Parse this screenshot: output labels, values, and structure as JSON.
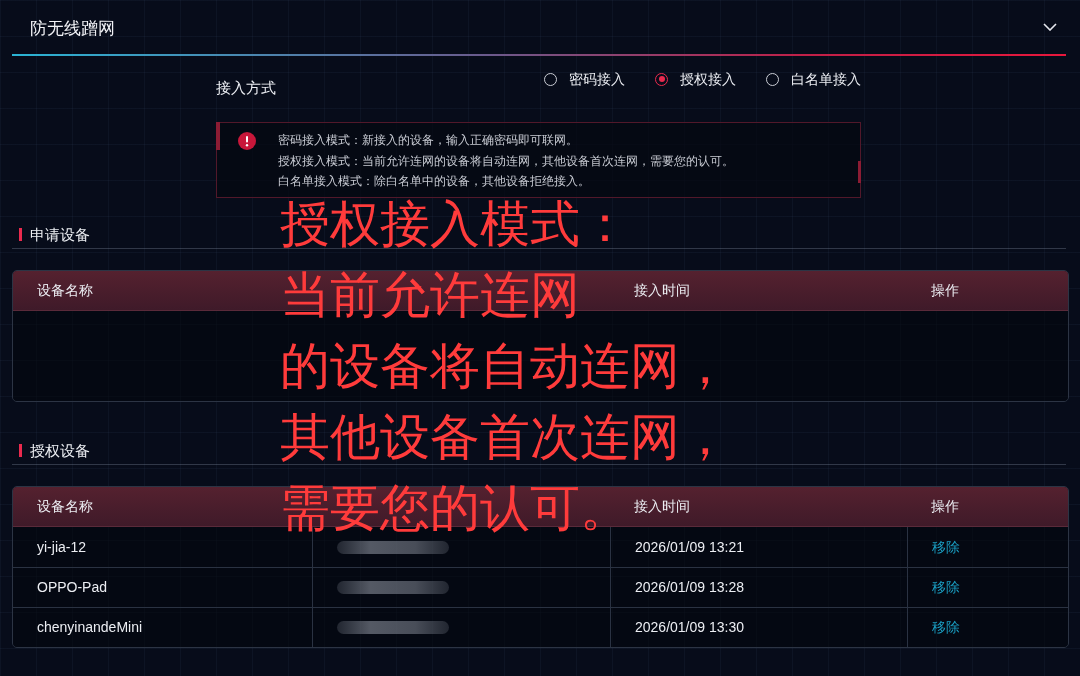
{
  "panel": {
    "title": "防无线蹭网"
  },
  "access_mode": {
    "label": "接入方式",
    "options": [
      {
        "label": "密码接入",
        "selected": false
      },
      {
        "label": "授权接入",
        "selected": true
      },
      {
        "label": "白名单接入",
        "selected": false
      }
    ]
  },
  "notice": {
    "lines": [
      "密码接入模式：新接入的设备，输入正确密码即可联网。",
      "授权接入模式：当前允许连网的设备将自动连网，其他设备首次连网，需要您的认可。",
      "白名单接入模式：除白名单中的设备，其他设备拒绝接入。"
    ]
  },
  "sections": [
    {
      "title": "申请设备",
      "columns": [
        "设备名称",
        null,
        "接入时间",
        "操作"
      ]
    },
    {
      "title": "授权设备",
      "columns": [
        "设备名称",
        null,
        "接入时间",
        "操作"
      ],
      "rows": [
        {
          "name": "yi-jia-12",
          "mac_redacted": true,
          "time": "2026/01/09 13:21",
          "action": "移除"
        },
        {
          "name": "OPPO-Pad",
          "mac_redacted": true,
          "time": "2026/01/09 13:28",
          "action": "移除"
        },
        {
          "name": "chenyinandeMini",
          "mac_redacted": true,
          "time": "2026/01/09 13:30",
          "action": "移除"
        }
      ]
    }
  ],
  "annotation": {
    "lines": [
      "授权接入模式：",
      "当前允许连网",
      "的设备将自动连网，",
      "其他设备首次连网，",
      "需要您的认可。"
    ]
  }
}
